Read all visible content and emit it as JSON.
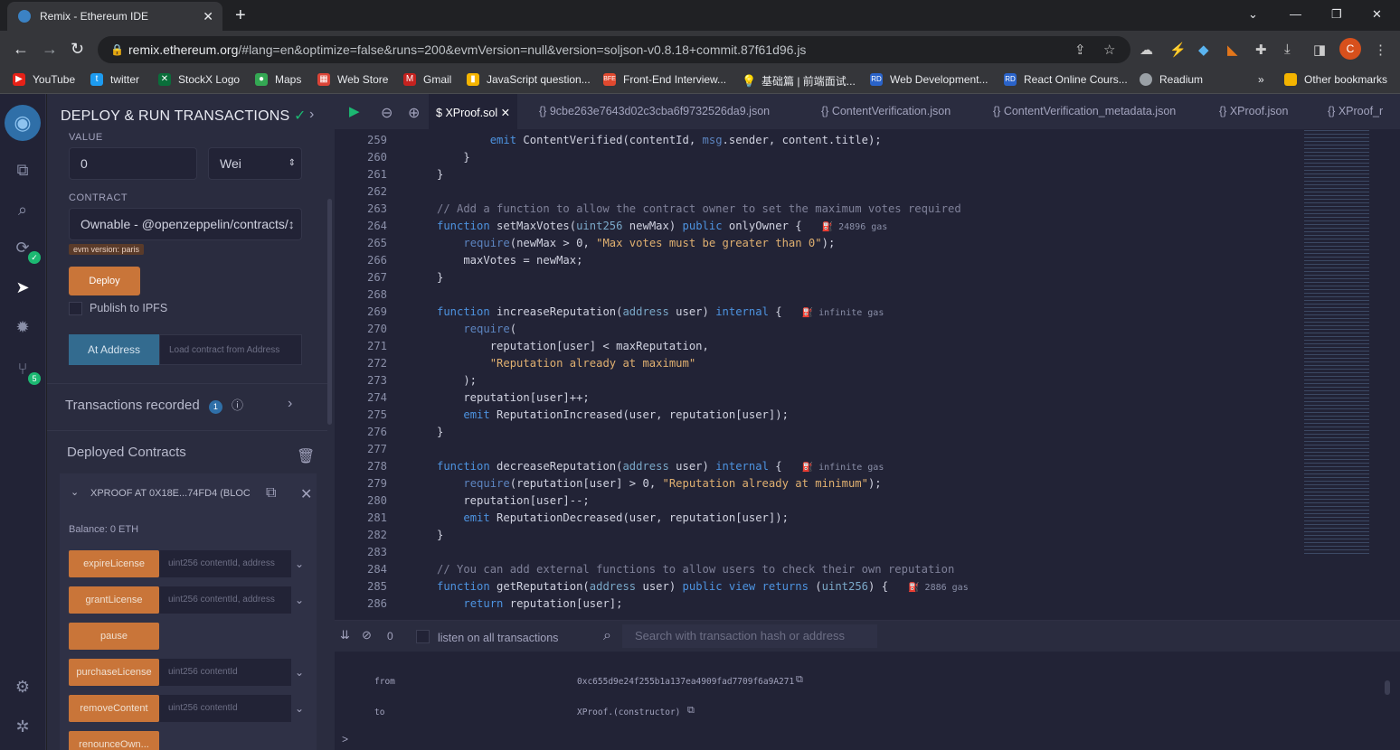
{
  "browser": {
    "tab_title": "Remix - Ethereum IDE",
    "url_host": "remix.ethereum.org",
    "url_path": "/#lang=en&optimize=false&runs=200&evmVersion=null&version=soljson-v0.8.18+commit.87f61d96.js",
    "avatar": "C"
  },
  "bookmarks": [
    "YouTube",
    "twitter",
    "StockX Logo",
    "Maps",
    "Web Store",
    "Gmail",
    "JavaScript question...",
    "Front-End Interview...",
    "基础篇 | 前端面试...",
    "Web Development...",
    "React Online Cours...",
    "Readium",
    "Other bookmarks"
  ],
  "icon_badges": {
    "plugins": "5"
  },
  "panel": {
    "title": "DEPLOY & RUN TRANSACTIONS",
    "value_label": "VALUE",
    "value": "0",
    "unit": "Wei",
    "contract_label": "CONTRACT",
    "contract": "Ownable - @openzeppelin/contracts/↕",
    "evm": "evm version: paris",
    "deploy": "Deploy",
    "publish": "Publish to IPFS",
    "at_address": "At Address",
    "load_placeholder": "Load contract from Address",
    "tx_recorded": "Transactions recorded",
    "tx_count": "1",
    "deployed": "Deployed Contracts",
    "instance": "XPROOF AT 0X18E...74FD4 (BLOC",
    "balance": "Balance: 0 ETH",
    "functions": [
      {
        "name": "expireLicense",
        "args": "uint256 contentId, address"
      },
      {
        "name": "grantLicense",
        "args": "uint256 contentId, address"
      },
      {
        "name": "pause",
        "args": ""
      },
      {
        "name": "purchaseLicense",
        "args": "uint256 contentId"
      },
      {
        "name": "removeContent",
        "args": "uint256 contentId"
      },
      {
        "name": "renounceOwn...",
        "args": ""
      }
    ]
  },
  "editor": {
    "tabs": [
      "XProof.sol",
      "9cbe263e7643d02c3cba6f9732526da9.json",
      "ContentVerification.json",
      "ContentVerification_metadata.json",
      "XProof.json",
      "XProof_r"
    ],
    "lines": [
      {
        "n": "259",
        "t": "            emit ContentVerified(contentId, msg.sender, content.title);"
      },
      {
        "n": "260",
        "t": "        }"
      },
      {
        "n": "261",
        "t": "    }"
      },
      {
        "n": "262",
        "t": ""
      },
      {
        "n": "263",
        "t": "    // Add a function to allow the contract owner to set the maximum votes required"
      },
      {
        "n": "264",
        "t": "    function setMaxVotes(uint256 newMax) public onlyOwner {",
        "gas": "24896 gas"
      },
      {
        "n": "265",
        "t": "        require(newMax > 0, \"Max votes must be greater than 0\");"
      },
      {
        "n": "266",
        "t": "        maxVotes = newMax;"
      },
      {
        "n": "267",
        "t": "    }"
      },
      {
        "n": "268",
        "t": ""
      },
      {
        "n": "269",
        "t": "    function increaseReputation(address user) internal {",
        "gas": "infinite gas"
      },
      {
        "n": "270",
        "t": "        require("
      },
      {
        "n": "271",
        "t": "            reputation[user] < maxReputation,"
      },
      {
        "n": "272",
        "t": "            \"Reputation already at maximum\""
      },
      {
        "n": "273",
        "t": "        );"
      },
      {
        "n": "274",
        "t": "        reputation[user]++;"
      },
      {
        "n": "275",
        "t": "        emit ReputationIncreased(user, reputation[user]);"
      },
      {
        "n": "276",
        "t": "    }"
      },
      {
        "n": "277",
        "t": ""
      },
      {
        "n": "278",
        "t": "    function decreaseReputation(address user) internal {",
        "gas": "infinite gas"
      },
      {
        "n": "279",
        "t": "        require(reputation[user] > 0, \"Reputation already at minimum\");"
      },
      {
        "n": "280",
        "t": "        reputation[user]--;"
      },
      {
        "n": "281",
        "t": "        emit ReputationDecreased(user, reputation[user]);"
      },
      {
        "n": "282",
        "t": "    }"
      },
      {
        "n": "283",
        "t": ""
      },
      {
        "n": "284",
        "t": "    // You can add external functions to allow users to check their own reputation"
      },
      {
        "n": "285",
        "t": "    function getReputation(address user) public view returns (uint256) {",
        "gas": "2886 gas"
      },
      {
        "n": "286",
        "t": "        return reputation[user];"
      }
    ]
  },
  "terminal": {
    "count": "0",
    "listen": "listen on all transactions",
    "search_placeholder": "Search with transaction hash or address",
    "from_label": "from",
    "from": "0xc655d9e24f255b1a137ea4909fad7709f6a9A271",
    "to_label": "to",
    "to": "XProof.(constructor)",
    "prompt": ">"
  }
}
